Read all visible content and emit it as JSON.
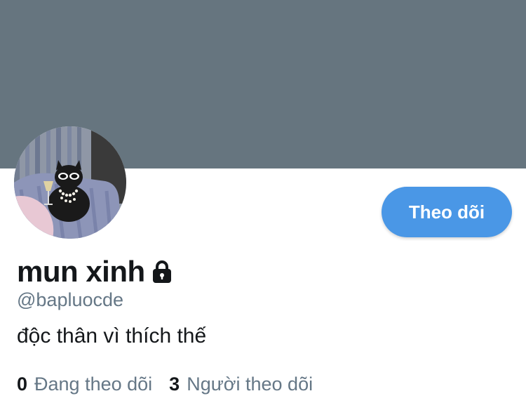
{
  "profile": {
    "display_name": "mun xinh",
    "handle": "@bapluocde",
    "bio": "độc thân vì thích thế",
    "protected_icon": "lock-icon",
    "avatar_alt": "black-cat-avatar"
  },
  "actions": {
    "follow_label": "Theo dõi"
  },
  "stats": {
    "following_count": "0",
    "following_label": "Đang theo dõi",
    "followers_count": "3",
    "followers_label": "Người theo dõi"
  },
  "colors": {
    "banner": "#66757f",
    "accent": "#4a97e6",
    "text_primary": "#14171a",
    "text_secondary": "#657786"
  }
}
